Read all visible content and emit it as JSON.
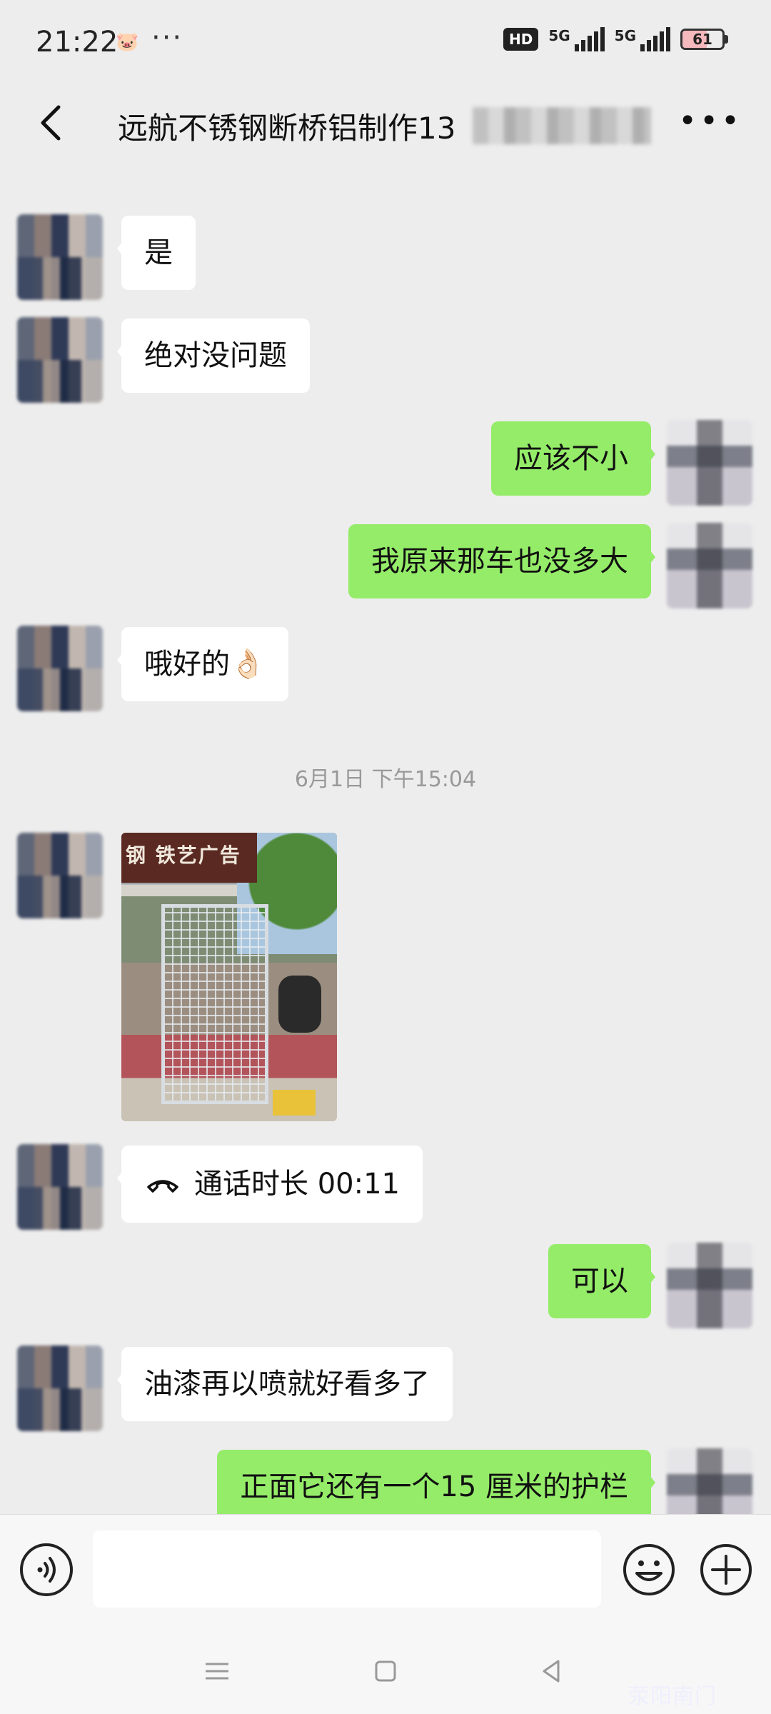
{
  "status_bar": {
    "time": "21:22",
    "dots": "···",
    "hd_label": "HD",
    "sim1_label": "5G",
    "sim2_label": "5G",
    "battery_percent": 61
  },
  "header": {
    "title": "远航不锈钢断桥铝制作13"
  },
  "messages": [
    {
      "side": "left",
      "text": "是"
    },
    {
      "side": "left",
      "text": "绝对没问题"
    },
    {
      "side": "right",
      "text": "应该不小"
    },
    {
      "side": "right",
      "text": "我原来那车也没多大"
    },
    {
      "side": "left",
      "text": "哦好的👌🏻"
    }
  ],
  "timestamp": "6月1日 下午15:04",
  "photo_sign": "钢 铁艺广告",
  "call": {
    "text": "通话时长 00:11"
  },
  "messages2": [
    {
      "side": "right",
      "text": "可以"
    },
    {
      "side": "left",
      "text": "油漆再以喷就好看多了"
    },
    {
      "side": "right",
      "text": "正面它还有一个15 厘米的护栏"
    }
  ],
  "watermark": "荥阳南门"
}
